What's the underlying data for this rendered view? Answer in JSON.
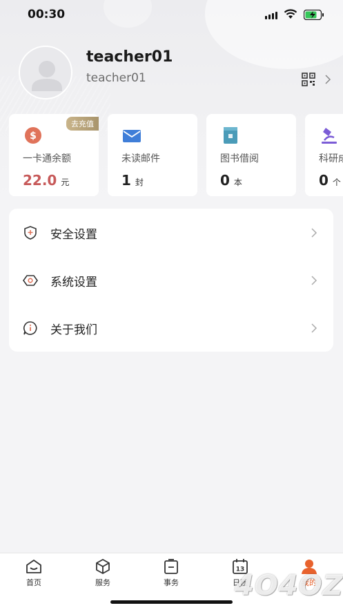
{
  "status_bar": {
    "time": "00:30"
  },
  "profile": {
    "name": "teacher01",
    "username": "teacher01"
  },
  "stats": [
    {
      "label": "一卡通余额",
      "value": "22.0",
      "unit": "元",
      "badge": "去充值",
      "icon": "dollar-icon",
      "color": "#e0735a"
    },
    {
      "label": "未读邮件",
      "value": "1",
      "unit": "封",
      "icon": "mail-icon",
      "color": "#3f7ed8"
    },
    {
      "label": "图书借阅",
      "value": "0",
      "unit": "本",
      "icon": "book-icon",
      "color": "#4a9bb8"
    },
    {
      "label": "科研成",
      "value": "0",
      "unit": "个",
      "icon": "microscope-icon",
      "color": "#7b5cd6"
    }
  ],
  "menu": [
    {
      "label": "安全设置",
      "icon": "shield-icon"
    },
    {
      "label": "系统设置",
      "icon": "settings-hex-icon"
    },
    {
      "label": "关于我们",
      "icon": "info-bubble-icon"
    }
  ],
  "tabs": [
    {
      "label": "首页",
      "icon": "home-icon"
    },
    {
      "label": "服务",
      "icon": "cube-icon"
    },
    {
      "label": "事务",
      "icon": "task-icon"
    },
    {
      "label": "日程",
      "icon": "calendar-icon"
    },
    {
      "label": "我的",
      "icon": "profile-icon",
      "active": true
    }
  ],
  "calendar_day": "13",
  "watermark": "4O4OZ",
  "colors": {
    "accent": "#e8622d",
    "balance": "#c75a5a"
  }
}
